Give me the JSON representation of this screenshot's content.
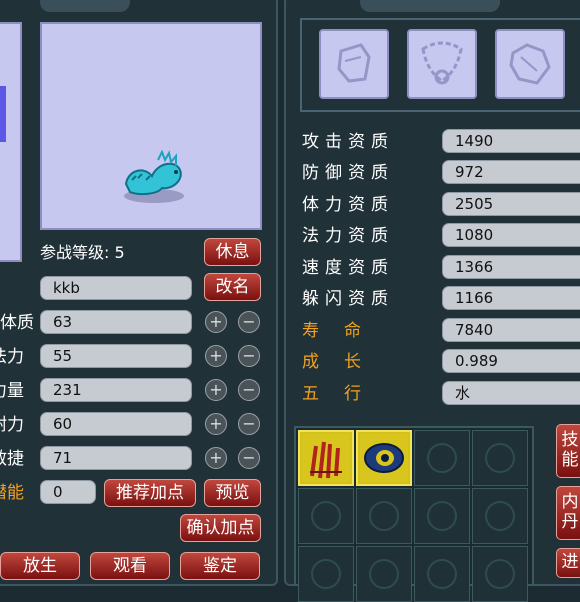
{
  "left": {
    "level_label": "参战等级: 5",
    "rest_button": "休息",
    "name_value": "kkb",
    "rename_button": "改名",
    "stats": [
      {
        "label": "体质",
        "value": "63"
      },
      {
        "label": "法力",
        "value": "55"
      },
      {
        "label": "力量",
        "value": "231"
      },
      {
        "label": "耐力",
        "value": "60"
      },
      {
        "label": "敏捷",
        "value": "71"
      }
    ],
    "potential_label": "潜能",
    "potential_value": "0",
    "recommend_button": "推荐加点",
    "preview_button": "预览",
    "confirm_button": "确认加点",
    "bottom_buttons": [
      "放生",
      "观看",
      "鉴定"
    ],
    "plus": "+",
    "minus": "−"
  },
  "right": {
    "attributes": [
      {
        "label": "攻击资质",
        "value": "1490"
      },
      {
        "label": "防御资质",
        "value": "972"
      },
      {
        "label": "体力资质",
        "value": "2505"
      },
      {
        "label": "法力资质",
        "value": "1080"
      },
      {
        "label": "速度资质",
        "value": "1366"
      },
      {
        "label": "躲闪资质",
        "value": "1166"
      }
    ],
    "lifespan": {
      "label": "寿　命",
      "value": "7840"
    },
    "growth": {
      "label": "成　长",
      "value": "0.989"
    },
    "element": {
      "label": "五　行",
      "value": "水"
    },
    "side_tabs": [
      "技能",
      "内丹",
      "进"
    ]
  },
  "colors": {
    "gold": "#f0a21e",
    "lavender": "#c7c8f0",
    "button_red": "#a32820",
    "skill_yellow": "#d4c21b"
  }
}
